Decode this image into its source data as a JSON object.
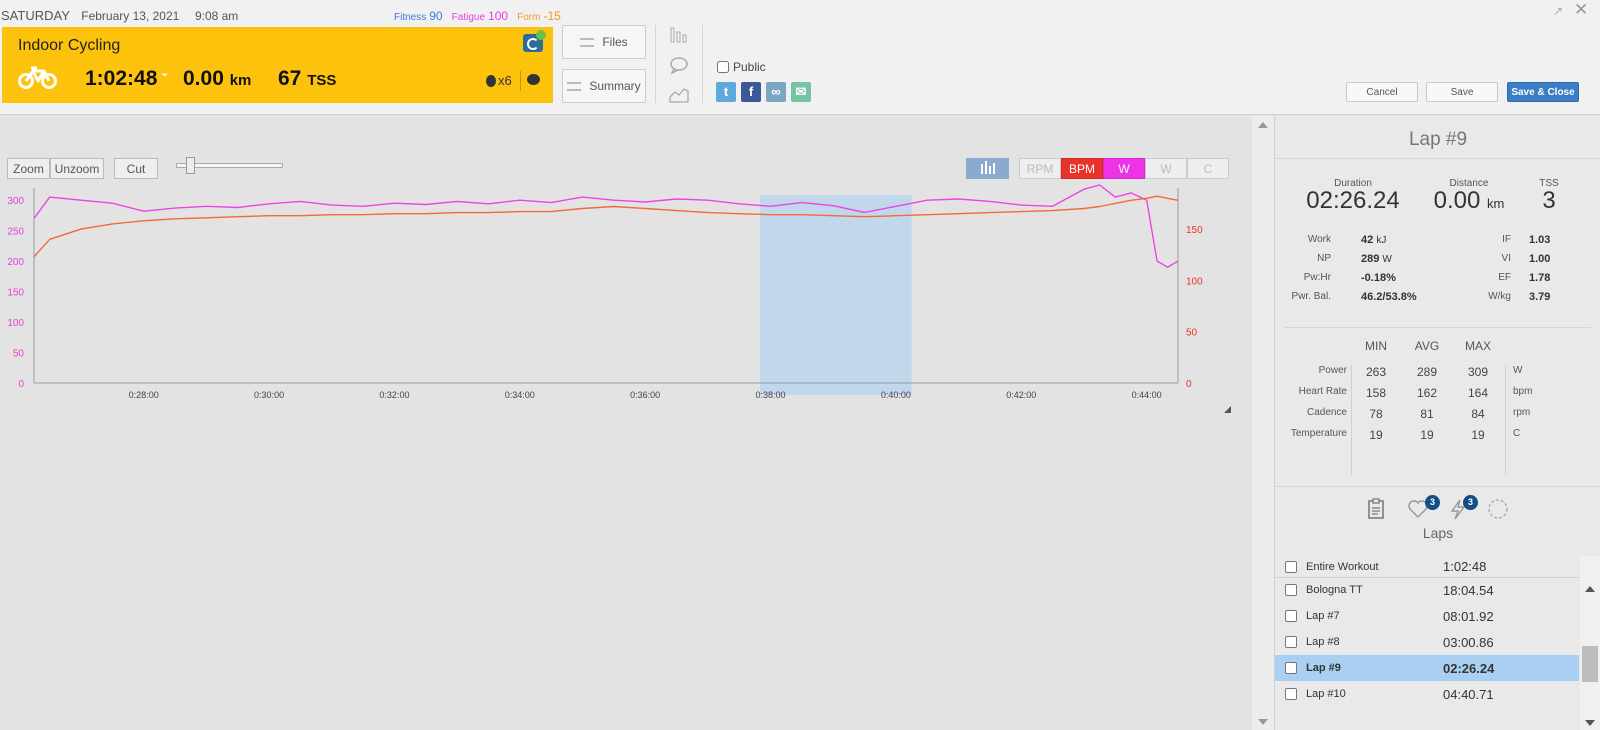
{
  "header": {
    "day": "SATURDAY",
    "date": "February 13, 2021",
    "time": "9:08 am",
    "fitness_label": "Fitness",
    "fitness_value": "90",
    "fatigue_label": "Fatigue",
    "fatigue_value": "100",
    "form_label": "Form",
    "form_value": "-15",
    "colors": {
      "fitness": "#3a7bd5",
      "fatigue": "#e83ed8",
      "form": "#f19b1d"
    }
  },
  "activity": {
    "title": "Indoor Cycling",
    "duration": "1:02:48",
    "distance": "0.00",
    "distance_unit": "km",
    "tss": "67",
    "tss_unit": "TSS",
    "achievements": "x6",
    "card_color": "#fcc20c",
    "icons": [
      "bike-icon",
      "sync-icon",
      "medal-icon",
      "comments-icon"
    ]
  },
  "toolbar": {
    "files_label": "Files",
    "summary_label": "Summary",
    "public_label": "Public",
    "public_checked": false,
    "cancel_label": "Cancel",
    "save_label": "Save",
    "save_close_label": "Save & Close"
  },
  "chart_controls": {
    "zoom_label": "Zoom",
    "unzoom_label": "Unzoom",
    "cut_label": "Cut",
    "channels": [
      {
        "label": "RPM",
        "active": false
      },
      {
        "label": "BPM",
        "active": true,
        "color": "#e8332a"
      },
      {
        "label": "W",
        "active": true,
        "color": "#ee33e6"
      },
      {
        "label": "W",
        "active": false
      },
      {
        "label": "C",
        "active": false
      }
    ]
  },
  "chart_data": {
    "type": "line",
    "x_unit": "elapsed time",
    "x_ticks": [
      "0:28:00",
      "0:30:00",
      "0:32:00",
      "0:34:00",
      "0:36:00",
      "0:38:00",
      "0:40:00",
      "0:42:00",
      "0:44:00"
    ],
    "xlim": [
      "0:26:15",
      "0:44:30"
    ],
    "y_left": {
      "ticks": [
        "300",
        "250",
        "200",
        "150",
        "100",
        "50",
        "0"
      ],
      "range": [
        0,
        320
      ],
      "color": "#e83ed8"
    },
    "y_right": {
      "ticks": [
        "150",
        "100",
        "50",
        "0"
      ],
      "range": [
        0,
        190
      ],
      "color": "#e8332a"
    },
    "selection": {
      "start": "0:37:50",
      "end": "0:40:15"
    },
    "series": [
      {
        "name": "W",
        "axis": "left",
        "color": "#ee44e4",
        "x": [
          "0:26:15",
          "0:26:30",
          "0:27:00",
          "0:27:30",
          "0:28:00",
          "0:28:30",
          "0:29:00",
          "0:29:30",
          "0:30:00",
          "0:30:30",
          "0:31:00",
          "0:31:30",
          "0:32:00",
          "0:32:30",
          "0:33:00",
          "0:33:30",
          "0:34:00",
          "0:34:30",
          "0:35:00",
          "0:35:30",
          "0:36:00",
          "0:36:30",
          "0:37:00",
          "0:37:30",
          "0:38:00",
          "0:38:30",
          "0:39:00",
          "0:39:30",
          "0:40:00",
          "0:40:30",
          "0:41:00",
          "0:41:30",
          "0:42:00",
          "0:42:30",
          "0:43:00",
          "0:43:15",
          "0:43:30",
          "0:43:45",
          "0:44:00",
          "0:44:10",
          "0:44:20",
          "0:44:30"
        ],
        "y": [
          270,
          305,
          300,
          295,
          282,
          287,
          290,
          288,
          294,
          298,
          292,
          290,
          295,
          293,
          298,
          294,
          300,
          296,
          305,
          300,
          297,
          302,
          300,
          294,
          290,
          296,
          291,
          280,
          290,
          300,
          302,
          298,
          292,
          290,
          318,
          325,
          305,
          312,
          300,
          200,
          190,
          200
        ]
      },
      {
        "name": "BPM",
        "axis": "right",
        "color": "#f26a3a",
        "x": [
          "0:26:15",
          "0:26:30",
          "0:27:00",
          "0:27:30",
          "0:28:00",
          "0:28:30",
          "0:29:00",
          "0:29:30",
          "0:30:00",
          "0:30:30",
          "0:31:00",
          "0:31:30",
          "0:32:00",
          "0:32:30",
          "0:33:00",
          "0:33:30",
          "0:34:00",
          "0:34:30",
          "0:35:00",
          "0:35:30",
          "0:36:00",
          "0:36:30",
          "0:37:00",
          "0:37:30",
          "0:38:00",
          "0:38:30",
          "0:39:00",
          "0:39:30",
          "0:40:00",
          "0:40:30",
          "0:41:00",
          "0:41:30",
          "0:42:00",
          "0:42:30",
          "0:43:00",
          "0:43:15",
          "0:43:30",
          "0:43:45",
          "0:44:00",
          "0:44:10",
          "0:44:20",
          "0:44:30"
        ],
        "y": [
          123,
          140,
          150,
          155,
          158,
          160,
          161,
          162,
          163,
          163,
          164,
          164,
          165,
          165,
          166,
          166,
          167,
          167,
          170,
          172,
          170,
          168,
          166,
          165,
          164,
          164,
          163,
          162,
          163,
          164,
          165,
          166,
          167,
          168,
          170,
          172,
          175,
          178,
          180,
          182,
          180,
          178
        ]
      }
    ]
  },
  "lap_detail": {
    "title": "Lap #9",
    "duration_label": "Duration",
    "duration": "02:26.24",
    "distance_label": "Distance",
    "distance": "0.00",
    "distance_unit": "km",
    "tss_label": "TSS",
    "tss": "3",
    "left_metrics": [
      {
        "key": "Work",
        "value": "42",
        "unit": "kJ"
      },
      {
        "key": "NP",
        "value": "289",
        "unit": "W"
      },
      {
        "key": "Pw:Hr",
        "value": "-0.18%",
        "unit": ""
      },
      {
        "key": "Pwr. Bal.",
        "value": "46.2/53.8%",
        "unit": ""
      }
    ],
    "right_metrics": [
      {
        "key": "IF",
        "value": "1.03"
      },
      {
        "key": "VI",
        "value": "1.00"
      },
      {
        "key": "EF",
        "value": "1.78"
      },
      {
        "key": "W/kg",
        "value": "3.79"
      }
    ],
    "minmax_headers": [
      "MIN",
      "AVG",
      "MAX"
    ],
    "minmax_rows": [
      {
        "label": "Power",
        "min": "263",
        "avg": "289",
        "max": "309",
        "unit": "W"
      },
      {
        "label": "Heart Rate",
        "min": "158",
        "avg": "162",
        "max": "164",
        "unit": "bpm"
      },
      {
        "label": "Cadence",
        "min": "78",
        "avg": "81",
        "max": "84",
        "unit": "rpm"
      },
      {
        "label": "Temperature",
        "min": "19",
        "avg": "19",
        "max": "19",
        "unit": "C"
      }
    ],
    "panel_icons": [
      {
        "name": "notes-icon"
      },
      {
        "name": "heart-icon",
        "badge": "3"
      },
      {
        "name": "lightning-icon",
        "badge": "3"
      },
      {
        "name": "dashed-circle-icon"
      }
    ],
    "laps_title": "Laps",
    "laps": [
      {
        "name": "Entire Workout",
        "time": "1:02:48",
        "selected": false
      },
      {
        "name": "Bologna TT",
        "time": "18:04.54",
        "selected": false
      },
      {
        "name": "Lap #7",
        "time": "08:01.92",
        "selected": false
      },
      {
        "name": "Lap #8",
        "time": "03:00.86",
        "selected": false
      },
      {
        "name": "Lap #9",
        "time": "02:26.24",
        "selected": true
      },
      {
        "name": "Lap #10",
        "time": "04:40.71",
        "selected": false
      }
    ]
  }
}
